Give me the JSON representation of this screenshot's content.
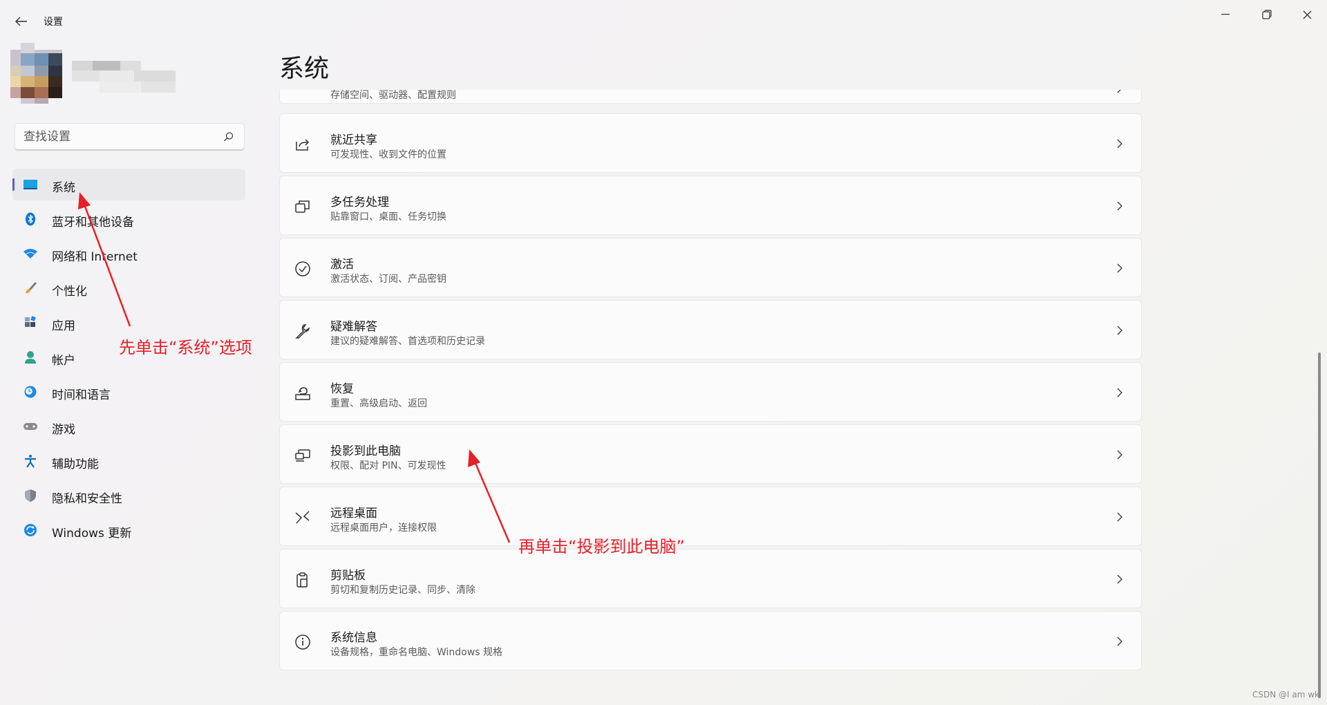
{
  "window": {
    "title": "设置",
    "back_icon": "arrow-left-icon",
    "minimize_icon": "minimize-icon",
    "maximize_icon": "restore-icon",
    "close_icon": "close-icon"
  },
  "search": {
    "placeholder": "查找设置",
    "icon": "search-icon"
  },
  "sidebar": {
    "items": [
      {
        "label": "系统",
        "icon": "monitor-icon",
        "active": true
      },
      {
        "label": "蓝牙和其他设备",
        "icon": "bluetooth-icon"
      },
      {
        "label": "网络和 Internet",
        "icon": "wifi-icon"
      },
      {
        "label": "个性化",
        "icon": "paintbrush-icon"
      },
      {
        "label": "应用",
        "icon": "apps-icon"
      },
      {
        "label": "帐户",
        "icon": "user-icon"
      },
      {
        "label": "时间和语言",
        "icon": "globe-clock-icon"
      },
      {
        "label": "游戏",
        "icon": "gamepad-icon"
      },
      {
        "label": "辅助功能",
        "icon": "accessibility-icon"
      },
      {
        "label": "隐私和安全性",
        "icon": "shield-icon"
      },
      {
        "label": "Windows 更新",
        "icon": "update-icon"
      }
    ]
  },
  "main": {
    "title": "系统",
    "partial_item_subtitle": "存储空间、驱动器、配置规则",
    "items": [
      {
        "title": "就近共享",
        "subtitle": "可发现性、收到文件的位置",
        "icon": "share-icon"
      },
      {
        "title": "多任务处理",
        "subtitle": "贴靠窗口、桌面、任务切换",
        "icon": "multitask-icon"
      },
      {
        "title": "激活",
        "subtitle": "激活状态、订阅、产品密钥",
        "icon": "check-circle-icon"
      },
      {
        "title": "疑难解答",
        "subtitle": "建议的疑难解答、首选项和历史记录",
        "icon": "wrench-icon"
      },
      {
        "title": "恢复",
        "subtitle": "重置、高级启动、返回",
        "icon": "recovery-icon"
      },
      {
        "title": "投影到此电脑",
        "subtitle": "权限、配对 PIN、可发现性",
        "icon": "project-icon"
      },
      {
        "title": "远程桌面",
        "subtitle": "远程桌面用户，连接权限",
        "icon": "remote-desktop-icon"
      },
      {
        "title": "剪贴板",
        "subtitle": "剪切和复制历史记录、同步、清除",
        "icon": "clipboard-icon"
      },
      {
        "title": "系统信息",
        "subtitle": "设备规格，重命名电脑、Windows 规格",
        "icon": "info-icon"
      }
    ]
  },
  "annotations": {
    "first": "先单击“系统”选项",
    "second": "再单击“投影到此电脑”"
  },
  "watermark": "CSDN @I am wk",
  "colors": {
    "accent": "#5b5fc7",
    "annotation": "#e8202a"
  }
}
